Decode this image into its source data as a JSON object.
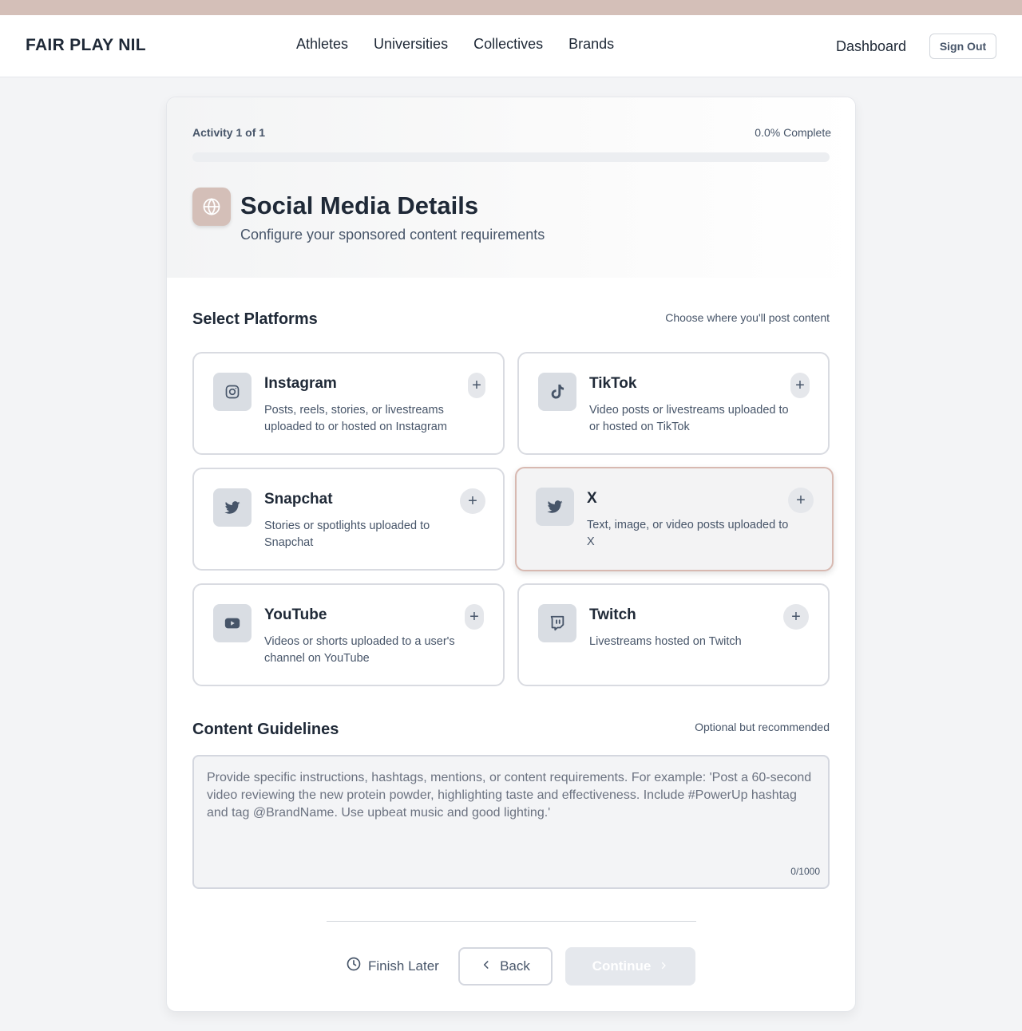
{
  "header": {
    "logo": "FAIR PLAY NIL",
    "nav": [
      "Athletes",
      "Universities",
      "Collectives",
      "Brands"
    ],
    "dashboard": "Dashboard",
    "sign_out": "Sign Out"
  },
  "progress": {
    "activity": "Activity 1 of 1",
    "complete": "0.0% Complete",
    "value": 0
  },
  "page": {
    "icon": "globe-icon",
    "title": "Social Media Details",
    "subtitle": "Configure your sponsored content requirements"
  },
  "platforms_section": {
    "title": "Select Platforms",
    "hint": "Choose where you'll post content",
    "items": [
      {
        "name": "Instagram",
        "description": "Posts, reels, stories, or livestreams uploaded to or hosted on Instagram",
        "icon": "instagram-icon",
        "selected": false
      },
      {
        "name": "TikTok",
        "description": "Video posts or livestreams uploaded to or hosted on TikTok",
        "icon": "tiktok-icon",
        "selected": false
      },
      {
        "name": "Snapchat",
        "description": "Stories or spotlights uploaded to Snapchat",
        "icon": "bird-icon",
        "selected": false
      },
      {
        "name": "X",
        "description": "Text, image, or video posts uploaded to X",
        "icon": "bird-icon",
        "selected": true
      },
      {
        "name": "YouTube",
        "description": "Videos or shorts uploaded to a user's channel on YouTube",
        "icon": "youtube-icon",
        "selected": false
      },
      {
        "name": "Twitch",
        "description": "Livestreams hosted on Twitch",
        "icon": "twitch-icon",
        "selected": false
      }
    ],
    "add_symbol": "+"
  },
  "guidelines": {
    "title": "Content Guidelines",
    "hint": "Optional but recommended",
    "placeholder": "Provide specific instructions, hashtags, mentions, or content requirements. For example: 'Post a 60-second video reviewing the new protein powder, highlighting taste and effectiveness. Include #PowerUp hashtag and tag @BrandName. Use upbeat music and good lighting.'",
    "value": "",
    "counter": "0/1000"
  },
  "footer": {
    "finish_later": "Finish Later",
    "back": "Back",
    "continue": "Continue"
  },
  "colors": {
    "accent": "#d4bfb8",
    "selected_border": "#d8b9b1",
    "text_primary": "#1f2937",
    "text_secondary": "#475569"
  }
}
